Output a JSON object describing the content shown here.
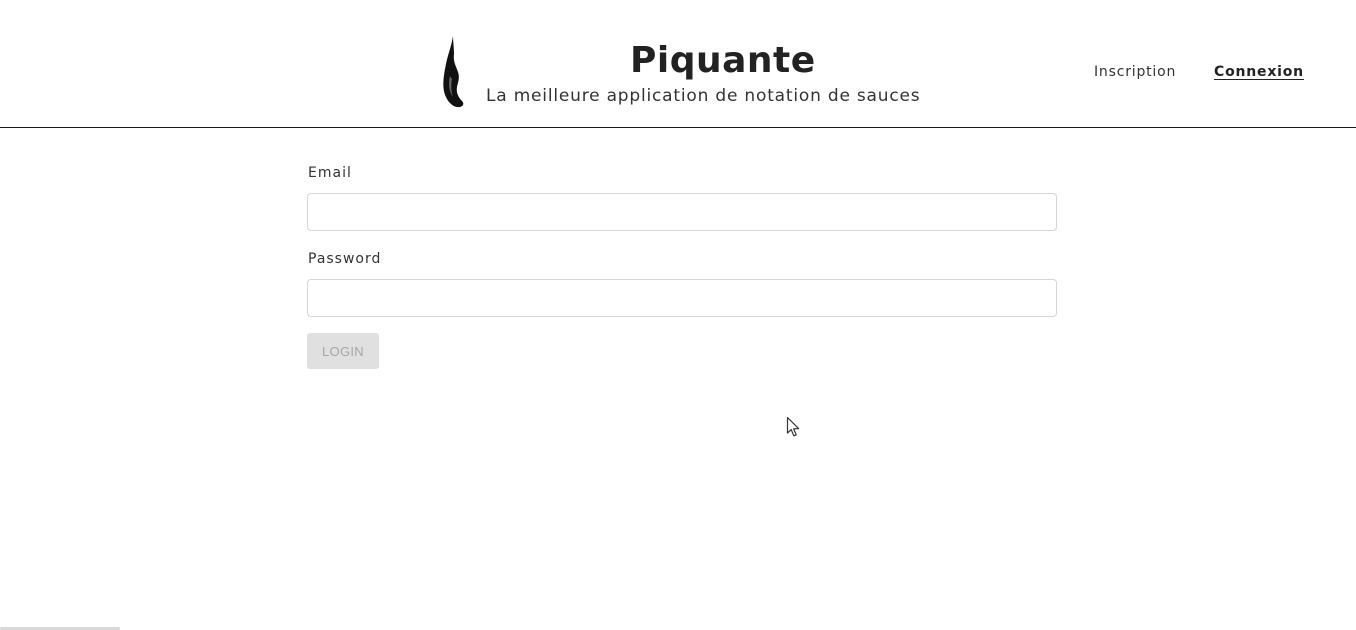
{
  "header": {
    "logo_icon": "flame-icon",
    "title": "Piquante",
    "subtitle": "La meilleure application de notation de sauces",
    "nav": {
      "inscription_label": "Inscription",
      "connexion_label": "Connexion"
    }
  },
  "login_form": {
    "email_label": "Email",
    "email_value": "",
    "password_label": "Password",
    "password_value": "",
    "submit_label": "LOGIN",
    "submit_disabled": true
  },
  "colors": {
    "header_border": "#1a1a1a",
    "button_disabled_bg": "#e0e0e0",
    "button_disabled_text": "#a6a6a6"
  },
  "cursor_icon": "mouse-pointer-icon"
}
